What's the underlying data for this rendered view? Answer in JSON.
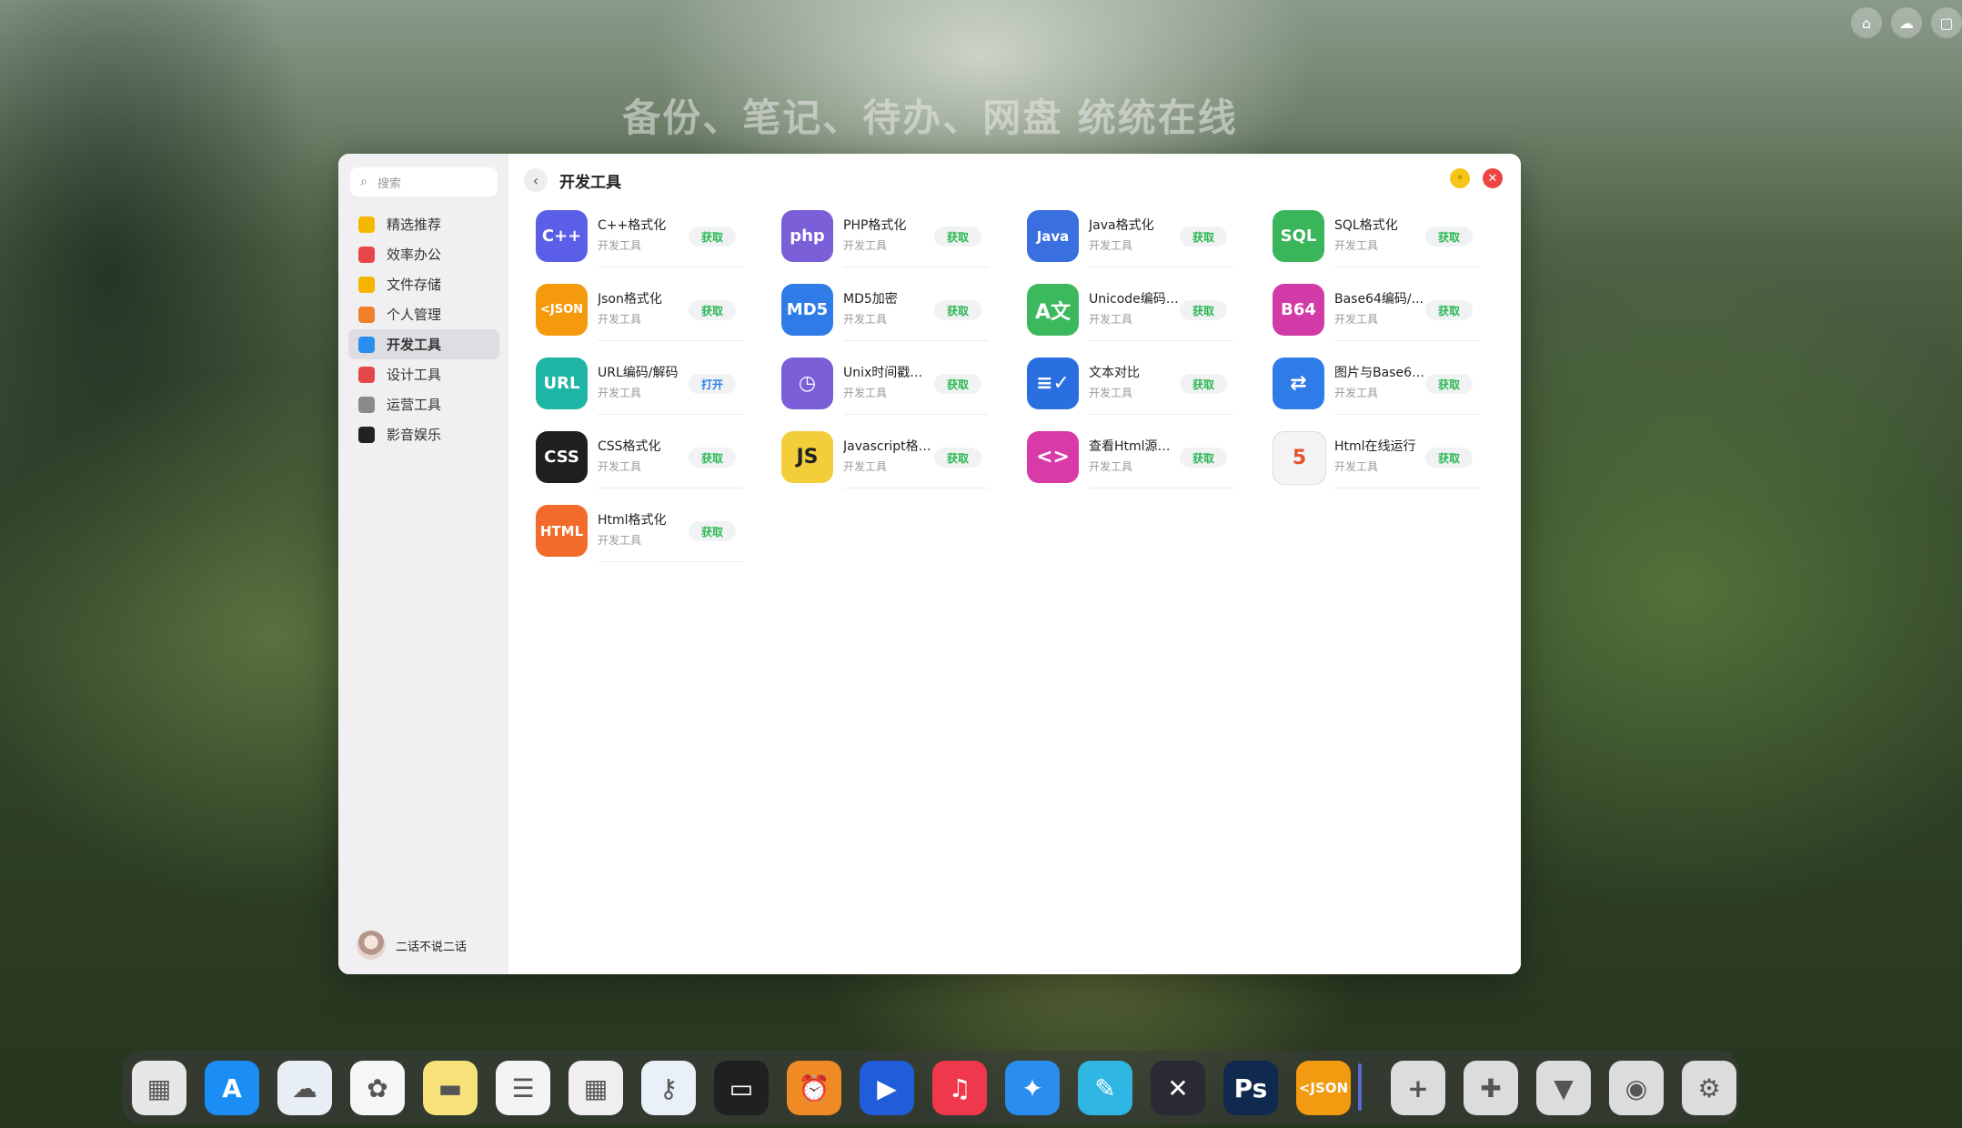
{
  "slogan": "备份、笔记、待办、网盘 统统在线",
  "search": {
    "placeholder": "搜索"
  },
  "sidebar": {
    "items": [
      {
        "label": "精选推荐",
        "icon": "star-icon",
        "color": "#f5b800"
      },
      {
        "label": "效率办公",
        "icon": "rocket-icon",
        "color": "#e8454a"
      },
      {
        "label": "文件存储",
        "icon": "folder-icon",
        "color": "#f5b400"
      },
      {
        "label": "个人管理",
        "icon": "person-card-icon",
        "color": "#f0802a"
      },
      {
        "label": "开发工具",
        "icon": "code-window-icon",
        "color": "#2a8ef0"
      },
      {
        "label": "设计工具",
        "icon": "palette-icon",
        "color": "#e34848"
      },
      {
        "label": "运营工具",
        "icon": "document-icon",
        "color": "#8a8a8a"
      },
      {
        "label": "影音娱乐",
        "icon": "clapperboard-icon",
        "color": "#222222"
      }
    ],
    "active_index": 4
  },
  "user": {
    "name": "二话不说二话"
  },
  "header": {
    "title": "开发工具"
  },
  "apps": [
    {
      "name": "C++格式化",
      "category": "开发工具",
      "action": "获取",
      "icon_text": "C++",
      "color": "#5b5ee6"
    },
    {
      "name": "PHP格式化",
      "category": "开发工具",
      "action": "获取",
      "icon_text": "php",
      "color": "#7b5fd8"
    },
    {
      "name": "Java格式化",
      "category": "开发工具",
      "action": "获取",
      "icon_text": "Java",
      "color": "#3a6fe0"
    },
    {
      "name": "SQL格式化",
      "category": "开发工具",
      "action": "获取",
      "icon_text": "SQL",
      "color": "#3bb55a"
    },
    {
      "name": "Json格式化",
      "category": "开发工具",
      "action": "获取",
      "icon_text": "<JSON",
      "color": "#f59a0c"
    },
    {
      "name": "MD5加密",
      "category": "开发工具",
      "action": "获取",
      "icon_text": "MD5",
      "color": "#2f7be8"
    },
    {
      "name": "Unicode编码/...",
      "category": "开发工具",
      "action": "获取",
      "icon_text": "A文",
      "color": "#3cb95c"
    },
    {
      "name": "Base64编码/...",
      "category": "开发工具",
      "action": "获取",
      "icon_text": "B64",
      "color": "#d23aa8"
    },
    {
      "name": "URL编码/解码",
      "category": "开发工具",
      "action": "打开",
      "icon_text": "URL",
      "color": "#1fb5a5"
    },
    {
      "name": "Unix时间戳转换",
      "category": "开发工具",
      "action": "获取",
      "icon_text": "◷",
      "color": "#7b5fd8"
    },
    {
      "name": "文本对比",
      "category": "开发工具",
      "action": "获取",
      "icon_text": "≡✓",
      "color": "#2a6fe0"
    },
    {
      "name": "图片与Base64...",
      "category": "开发工具",
      "action": "获取",
      "icon_text": "⇄",
      "color": "#2f7be8"
    },
    {
      "name": "CSS格式化",
      "category": "开发工具",
      "action": "获取",
      "icon_text": "CSS",
      "color": "#1f1f22"
    },
    {
      "name": "Javascript格式...",
      "category": "开发工具",
      "action": "获取",
      "icon_text": "JS",
      "color": "#f2cf3a"
    },
    {
      "name": "查看Html源代码",
      "category": "开发工具",
      "action": "获取",
      "icon_text": "<>",
      "color": "#d83aa8"
    },
    {
      "name": "Html在线运行",
      "category": "开发工具",
      "action": "获取",
      "icon_text": "5",
      "color": "#f4f4f4"
    },
    {
      "name": "Html格式化",
      "category": "开发工具",
      "action": "获取",
      "icon_text": "HTML",
      "color": "#f26b2a"
    }
  ],
  "action_colors": {
    "获取": "#2db854",
    "打开": "#2a7fe8"
  },
  "dock": [
    {
      "name": "launchpad",
      "icon": "grid-apps-icon",
      "color": "#e7e7e7",
      "text": "▦"
    },
    {
      "name": "app-store",
      "icon": "app-store-icon",
      "color": "#1a8ef5",
      "text": "A"
    },
    {
      "name": "cloud",
      "icon": "cloud-icon",
      "color": "#e8eef6",
      "text": "☁"
    },
    {
      "name": "photos",
      "icon": "photos-icon",
      "color": "#f6f6f6",
      "text": "✿"
    },
    {
      "name": "notes",
      "icon": "notes-icon",
      "color": "#f7e27a",
      "text": "▬"
    },
    {
      "name": "reminders",
      "icon": "reminders-icon",
      "color": "#f4f4f4",
      "text": "☰"
    },
    {
      "name": "calendar",
      "icon": "calendar-icon",
      "color": "#f0eeee",
      "text": "▦"
    },
    {
      "name": "passwords",
      "icon": "key-icon",
      "color": "#e9f0f7",
      "text": "⚷"
    },
    {
      "name": "wallet",
      "icon": "wallet-icon",
      "color": "#202020",
      "text": "▭"
    },
    {
      "name": "clock",
      "icon": "alarm-clock-icon",
      "color": "#f08a24",
      "text": "⏰"
    },
    {
      "name": "video-player",
      "icon": "play-icon",
      "color": "#1f5ed8",
      "text": "▶"
    },
    {
      "name": "music",
      "icon": "music-icon",
      "color": "#f0384c",
      "text": "♫"
    },
    {
      "name": "safari",
      "icon": "compass-icon",
      "color": "#2a8ef0",
      "text": "✦"
    },
    {
      "name": "freeform",
      "icon": "pencil-icon",
      "color": "#2fb6e3",
      "text": "✎"
    },
    {
      "name": "flow",
      "icon": "flow-lines-icon",
      "color": "#2a2a34",
      "text": "✕"
    },
    {
      "name": "photoshop",
      "icon": "photoshop-icon",
      "color": "#0f2a4e",
      "text": "Ps"
    },
    {
      "name": "json",
      "icon": "json-icon",
      "color": "#f29a10",
      "text": "<JSON"
    },
    {
      "name": "add",
      "icon": "plus-icon",
      "color": "#dcdcdc",
      "text": "+"
    },
    {
      "name": "plugins",
      "icon": "puzzle-icon",
      "color": "#dcdcdc",
      "text": "✚"
    },
    {
      "name": "brush",
      "icon": "brush-icon",
      "color": "#dcdcdc",
      "text": "▼"
    },
    {
      "name": "settings-gear",
      "icon": "settings-circle-icon",
      "color": "#dcdcdc",
      "text": "◉"
    },
    {
      "name": "system-settings",
      "icon": "gear-icon",
      "color": "#dcdcdc",
      "text": "⚙"
    }
  ],
  "top_bar": [
    {
      "name": "home",
      "icon": "home-icon",
      "text": "⌂"
    },
    {
      "name": "cloud",
      "icon": "cloud-icon",
      "text": "☁"
    },
    {
      "name": "window",
      "icon": "window-icon",
      "text": "▢"
    }
  ]
}
